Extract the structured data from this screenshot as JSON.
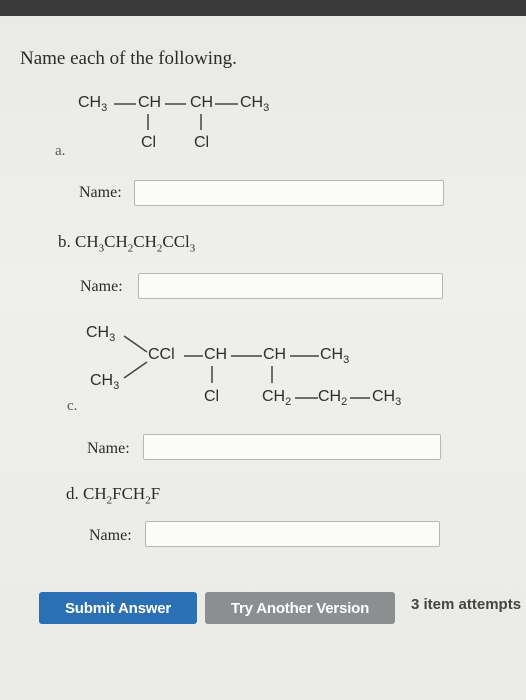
{
  "instruction": "Name each of the following.",
  "questions": [
    {
      "letter": "a.",
      "structure": {
        "main_chain": [
          "CH3",
          "CH",
          "CH",
          "CH3"
        ],
        "substituents": [
          "Cl",
          "Cl"
        ]
      },
      "name_label": "Name:",
      "answer": ""
    },
    {
      "letter": "b.",
      "formula": "CH3CH2CH2CCl3",
      "name_label": "Name:",
      "answer": ""
    },
    {
      "letter": "c.",
      "structure": {
        "left_groups": [
          "CH3",
          "CH3"
        ],
        "main_chain": [
          "CCl",
          "CH",
          "CH",
          "CH3"
        ],
        "substituent_cl": "Cl",
        "branch": [
          "CH2",
          "CH2",
          "CH3"
        ]
      },
      "name_label": "Name:",
      "answer": ""
    },
    {
      "letter": "d.",
      "formula": "CH2FCH2F",
      "name_label": "Name:",
      "answer": ""
    }
  ],
  "buttons": {
    "submit": "Submit Answer",
    "try_another": "Try Another Version"
  },
  "attempts_text": "3 item attempts",
  "colors": {
    "submit_bg": "#2b6fb5",
    "try_bg": "#8c8f92"
  }
}
